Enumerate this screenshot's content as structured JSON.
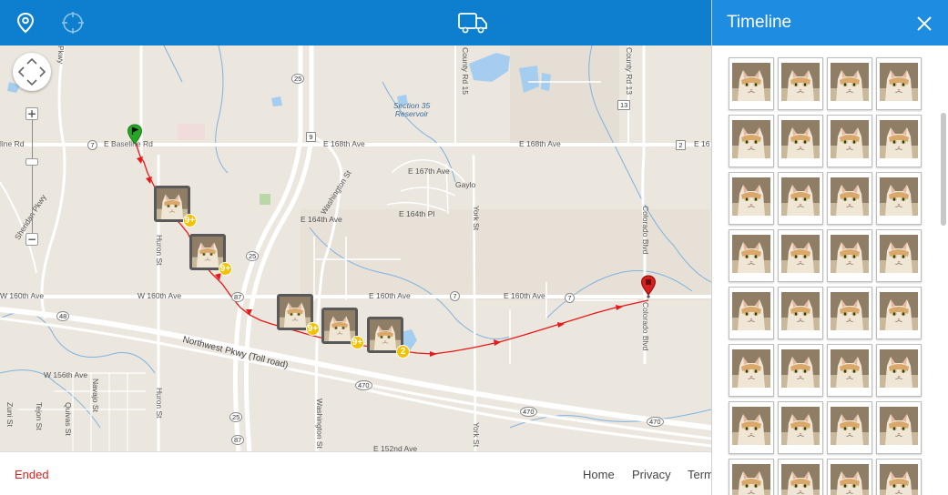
{
  "topbar": {
    "icons": [
      "location-pin-icon",
      "crosshair-icon",
      "delivery-truck-icon"
    ]
  },
  "map": {
    "road_labels": {
      "e_baseline_rd": "E Baseline Rd",
      "baseline_left": "line Rd",
      "e_168th_ave_1": "E 168th Ave",
      "e_168th_ave_2": "E 168th Ave",
      "e_168_right": "E 16",
      "w_160th_ave_1": "W 160th Ave",
      "w_160th_ave_2": "W 160th Ave",
      "e_160th_ave_1": "E 160th Ave",
      "e_160th_ave_2": "E 160th Ave",
      "e_167th_ave": "E 167th Ave",
      "e_164th_ave": "E 164th Ave",
      "e_164th_pl": "E 164th Pl",
      "w_156th_ave": "W 156th Ave",
      "e_152nd_ave": "E 152nd Ave",
      "washington_st_1": "Washington St",
      "washington_st_2": "Washington St",
      "huron_st_1": "Huron St",
      "huron_st_2": "Huron St",
      "york_st_1": "York St",
      "york_st_2": "York St",
      "colorado_blvd_1": "Colorado Blvd",
      "colorado_blvd_2": "Colorado Blvd",
      "county_rd_13": "County Rd 13",
      "county_rd_15": "County Rd 15",
      "sheridan_pkwy": "Sheridan Pkwy",
      "northwest_pkwy": "Northwest Pkwy (Toll road)",
      "gaylord": "Gaylo",
      "navajo_st": "Navajo St",
      "quivas_st": "Quivas St",
      "tejon_st": "Tejon St",
      "zuni_st": "Zuni St",
      "pkwy_top": "Pkwy",
      "section35_reservoir": "Section 35\nReservoir"
    },
    "shields": {
      "s7a": "7",
      "s9": "9",
      "s25": "25",
      "s2": "2",
      "s13": "13",
      "s87a": "87",
      "s7b": "7",
      "s7c": "7",
      "s48": "48",
      "s470a": "470",
      "s470b": "470",
      "s470c": "470",
      "s25b": "25",
      "s87b": "87",
      "s25c": "25"
    },
    "photo_markers": [
      {
        "count": "9+"
      },
      {
        "count": "9+"
      },
      {
        "count": "9+"
      },
      {
        "count": "9+"
      },
      {
        "count": "2"
      }
    ]
  },
  "footer": {
    "status": "Ended",
    "links": {
      "home": "Home",
      "privacy": "Privacy",
      "terms": "Terms"
    }
  },
  "timeline": {
    "title": "Timeline",
    "thumbnail_count": 32
  },
  "colors": {
    "topbar": "#0e7fcf",
    "timeline_header": "#1e8ce0",
    "route": "#e8191a",
    "start_pin": "#27a527",
    "end_pin": "#d61f1f",
    "status": "#e0201e",
    "badge": "#f2c200"
  }
}
